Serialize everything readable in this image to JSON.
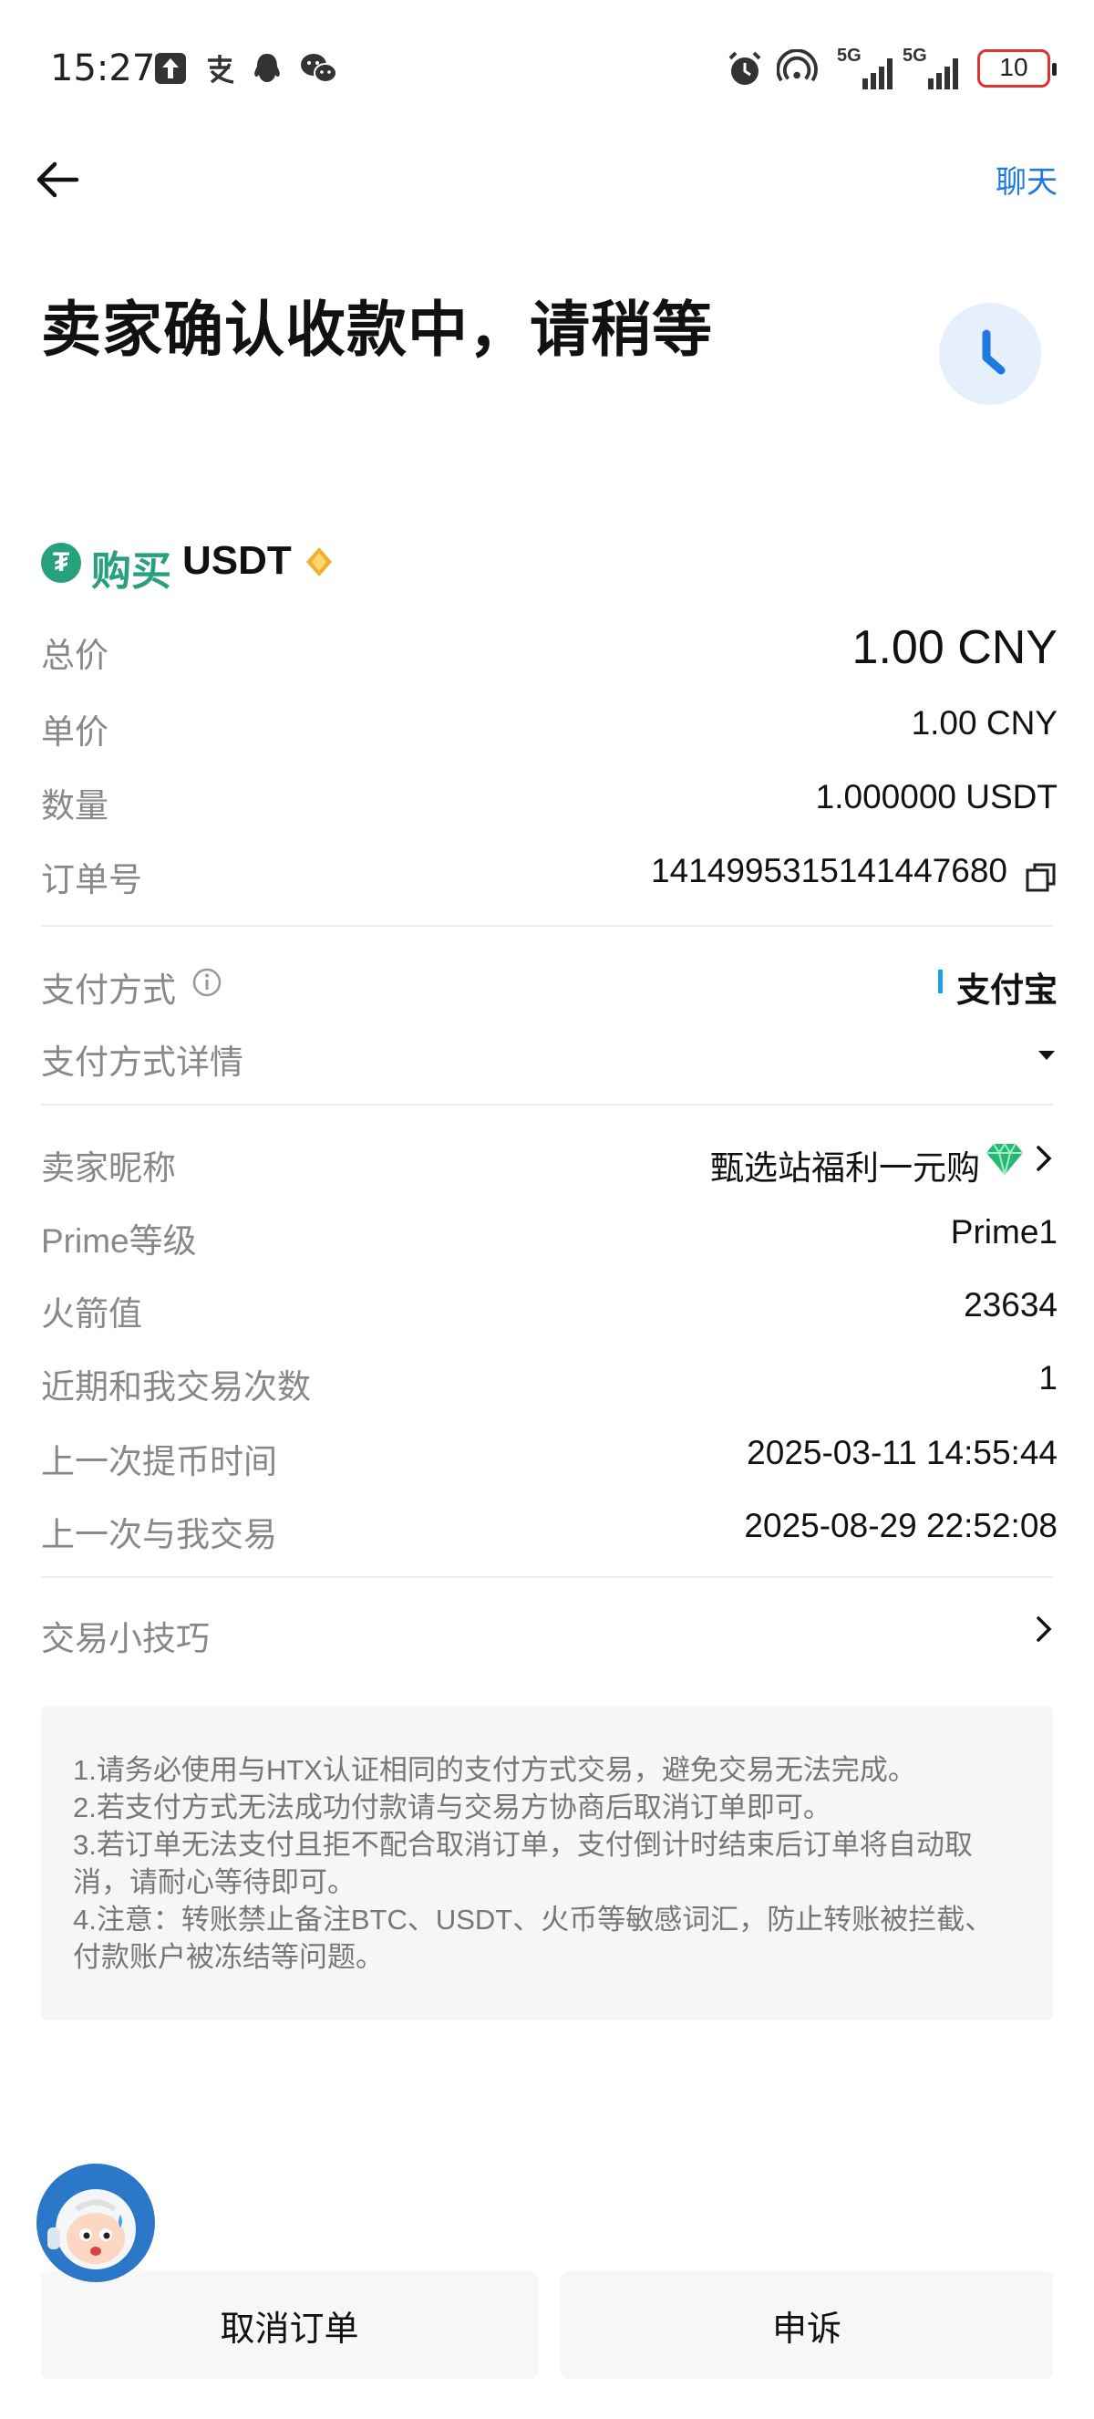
{
  "status_bar": {
    "time": "15:27",
    "network_label": "5G",
    "battery": "10"
  },
  "header": {
    "back_icon": "arrow-left-icon",
    "chat_label": "聊天"
  },
  "title": "卖家确认收款中，请稍等",
  "order": {
    "action": "购买",
    "coin": "USDT",
    "rows": [
      {
        "label": "总价",
        "value": "1.00 CNY"
      },
      {
        "label": "单价",
        "value": "1.00 CNY"
      },
      {
        "label": "数量",
        "value": "1.000000 USDT"
      },
      {
        "label": "订单号",
        "value": "1414995315141447680"
      }
    ]
  },
  "payment": {
    "method_label": "支付方式",
    "method_value": "支付宝",
    "details_label": "支付方式详情"
  },
  "seller": {
    "rows": [
      {
        "label": "卖家昵称",
        "value": "甄选站福利一元购"
      },
      {
        "label": "Prime等级",
        "value": "Prime1"
      },
      {
        "label": "火箭值",
        "value": "23634"
      },
      {
        "label": "近期和我交易次数",
        "value": "1"
      },
      {
        "label": "上一次提币时间",
        "value": "2025-03-11 14:55:44"
      },
      {
        "label": "上一次与我交易",
        "value": "2025-08-29 22:52:08"
      }
    ]
  },
  "tips_label": "交易小技巧",
  "notice": [
    "1.请务必使用与HTX认证相同的支付方式交易，避免交易无法完成。",
    "2.若支付方式无法成功付款请与交易方协商后取消订单即可。",
    "3.若订单无法支付且拒不配合取消订单，支付倒计时结束后订单将自动取消，请耐心等待即可。",
    "4.注意：转账禁止备注BTC、USDT、火币等敏感词汇，防止转账被拦截、付款账户被冻结等问题。"
  ],
  "buttons": {
    "cancel": "取消订单",
    "appeal": "申诉"
  },
  "colors": {
    "accent": "#1f7ae0",
    "buy": "#26a17b",
    "alipay": "#1aa3e6"
  }
}
